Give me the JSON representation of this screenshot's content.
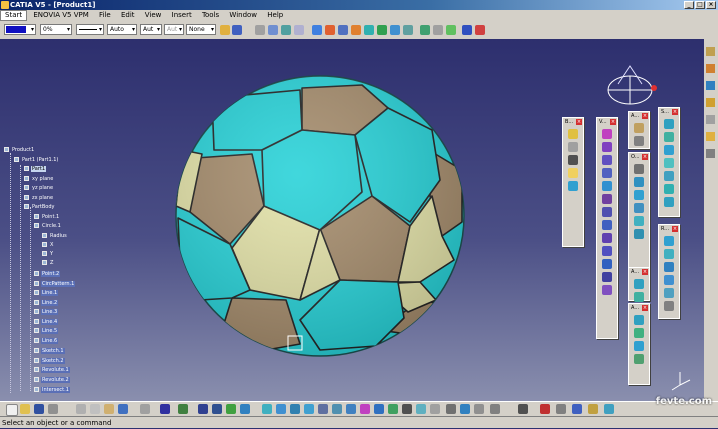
{
  "window": {
    "title": "CATIA V5 - [Product1]"
  },
  "menu": [
    "Start",
    "ENOVIA V5 VPM",
    "File",
    "Edit",
    "View",
    "Insert",
    "Tools",
    "Window",
    "Help"
  ],
  "properties_toolbar": {
    "transparency": "0%",
    "line_weight": "Auto",
    "layer": "Aut",
    "linetype": "Aut",
    "layer_filter": "None"
  },
  "tree": [
    "Product1",
    "Part1 (Part1.1)",
    "Part1",
    "xy plane",
    "yz plane",
    "zx plane",
    "PartBody",
    "Point.1",
    "Circle.1",
    "Radius",
    "X",
    "Y",
    "Z",
    "Point.2",
    "CircPattern.1",
    "Line.1",
    "Line.2",
    "Line.3",
    "Line.4",
    "Line.5",
    "Line.6",
    "Sketch.1",
    "Sketch.2",
    "Revolute.1",
    "Revolute.2",
    "Intersect.1"
  ],
  "floating_toolbars": {
    "t1": "B...",
    "t2": "V...",
    "t3": "A...",
    "t4": "S...",
    "t5": "O...",
    "t6": "R...",
    "t7": "A...",
    "t8": "A..."
  },
  "status": {
    "text": "Select an object or a command"
  },
  "watermark": "fevte.com",
  "colors": {
    "ball_cyan": "#27d2d8",
    "ball_tan": "#a58c6c",
    "ball_cream": "#e3e2a8",
    "viewport_top": "#2d2f6e",
    "viewport_bottom": "#8a8fae"
  }
}
